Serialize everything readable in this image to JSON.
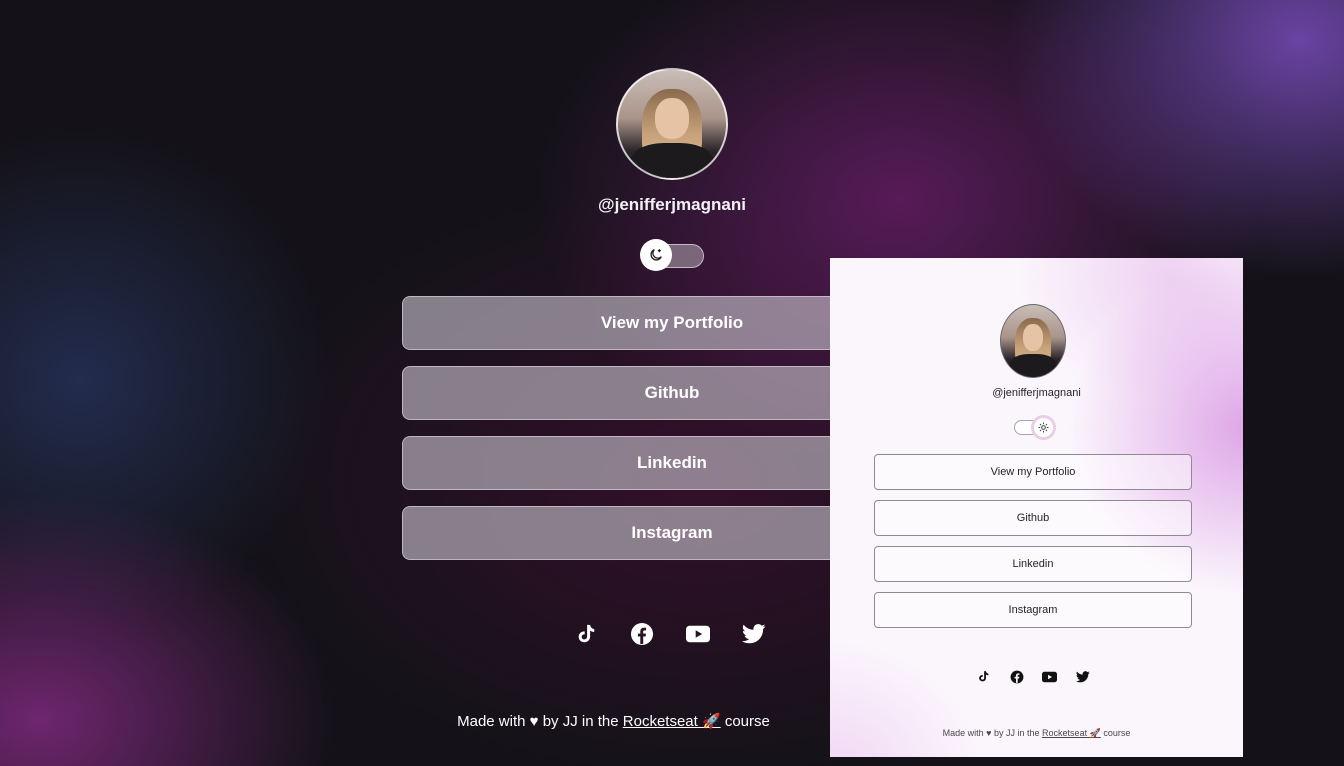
{
  "dark_profile": {
    "handle": "@jenifferjmagnani",
    "theme_toggle": {
      "mode": "dark",
      "icon": "moon-icon"
    },
    "links": [
      {
        "label": "View my Portfolio"
      },
      {
        "label": "Github"
      },
      {
        "label": "Linkedin"
      },
      {
        "label": "Instagram"
      }
    ],
    "social": [
      "tiktok-icon",
      "facebook-icon",
      "youtube-icon",
      "twitter-icon"
    ],
    "footer": {
      "prefix": "Made with ♥ by JJ in the ",
      "link": "Rocketseat",
      "rocket": "🚀",
      "suffix": " course"
    }
  },
  "light_preview": {
    "handle": "@jenifferjmagnani",
    "theme_toggle": {
      "mode": "light",
      "icon": "sun-icon"
    },
    "links": [
      {
        "label": "View my Portfolio"
      },
      {
        "label": "Github"
      },
      {
        "label": "Linkedin"
      },
      {
        "label": "Instagram"
      }
    ],
    "social": [
      "tiktok-icon",
      "facebook-icon",
      "youtube-icon",
      "twitter-icon"
    ],
    "footer": {
      "prefix": "Made with ♥ by JJ in the ",
      "link": "Rocketseat",
      "rocket": "🚀",
      "suffix": " course"
    }
  },
  "colors": {
    "dark_background": "#141218",
    "light_background": "#fbf6fc",
    "accent_purple": "#6e46aa"
  }
}
